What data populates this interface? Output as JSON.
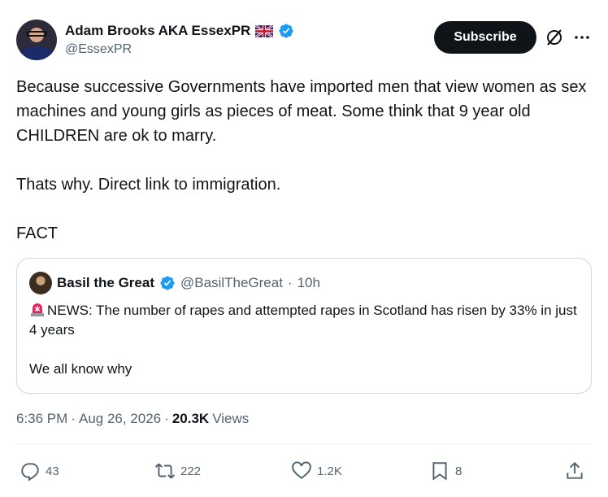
{
  "author": {
    "display_name": "Adam Brooks AKA EssexPR",
    "handle": "@EssexPR"
  },
  "header": {
    "subscribe_label": "Subscribe"
  },
  "tweet": {
    "paragraphs": [
      "Because successive Governments have imported men that view women as sex machines and young girls as pieces of meat. Some think that 9 year old CHILDREN are ok to marry.",
      "Thats why. Direct link to immigration.",
      "FACT"
    ]
  },
  "quote": {
    "display_name": "Basil the Great",
    "handle": "@BasilTheGreat",
    "separator": "·",
    "time": "10h",
    "lines": [
      "NEWS: The number of rapes and attempted rapes in Scotland has risen by 33% in just 4 years",
      "We all know why"
    ]
  },
  "meta": {
    "time": "6:36 PM",
    "sep1": "·",
    "date": "Aug 26, 2026",
    "sep2": "·",
    "views_count": "20.3K",
    "views_label": "Views"
  },
  "actions": {
    "replies": "43",
    "reposts": "222",
    "likes": "1.2K",
    "bookmarks": "8"
  },
  "colors": {
    "text": "#0f1419",
    "secondary": "#536471",
    "verified": "#1d9bf0",
    "border": "#cfd9de"
  },
  "icons": [
    "verified-badge-icon",
    "uk-flag-icon",
    "grok-icon",
    "more-icon",
    "siren-icon",
    "reply-icon",
    "repost-icon",
    "like-icon",
    "bookmark-icon",
    "share-icon"
  ]
}
